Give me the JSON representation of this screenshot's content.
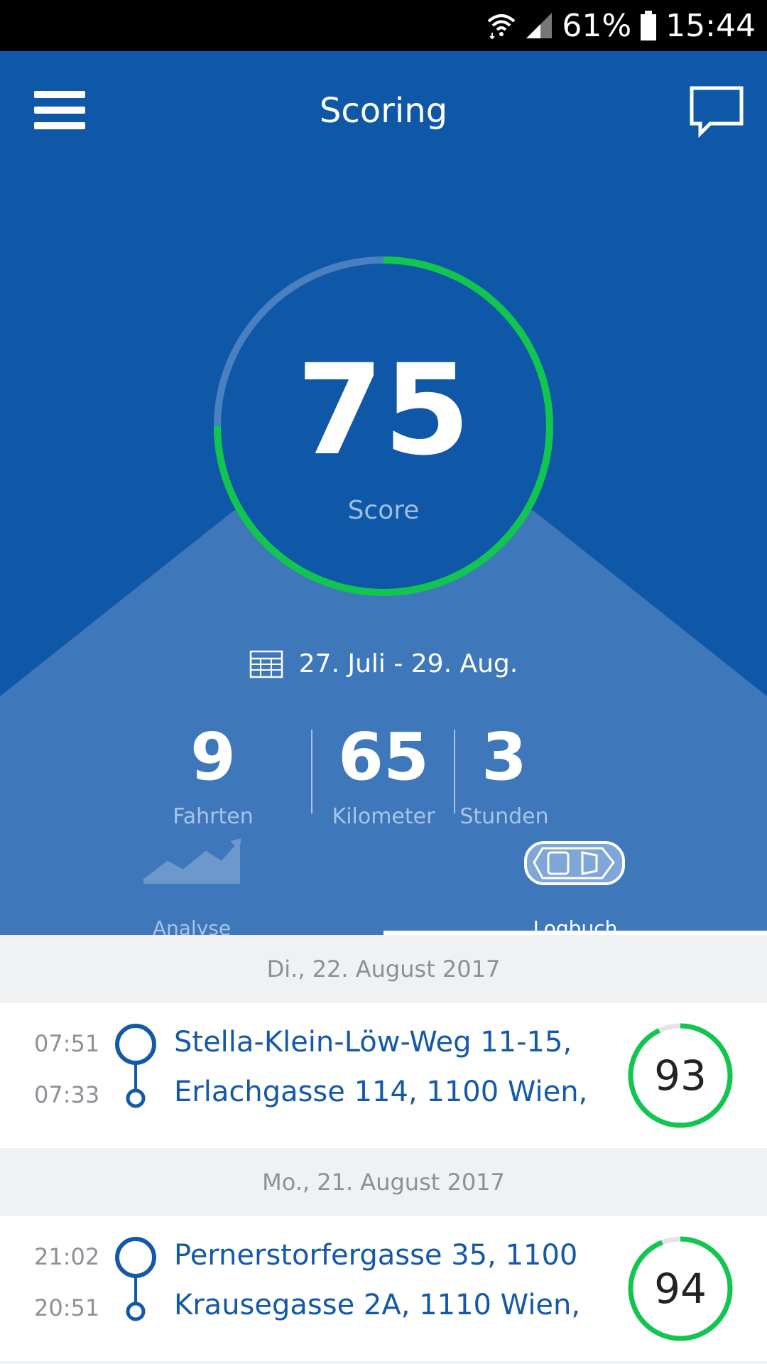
{
  "status_bar": {
    "battery": "61%",
    "time": "15:44"
  },
  "appbar": {
    "title": "Scoring"
  },
  "score": {
    "value": "75",
    "label": "Score",
    "fraction": 0.75
  },
  "period": {
    "range": "27. Juli - 29. Aug."
  },
  "stats": [
    {
      "value": "9",
      "label": "Fahrten"
    },
    {
      "value": "65",
      "label": "Kilometer"
    },
    {
      "value": "3",
      "label": "Stunden"
    }
  ],
  "tabs": [
    {
      "label": "Analyse",
      "active": false
    },
    {
      "label": "Logbuch",
      "active": true
    }
  ],
  "trip_groups": [
    {
      "date": "Di., 22. August 2017",
      "trip": {
        "end_time": "07:51",
        "start_time": "07:33",
        "end_address": "Stella-Klein-Löw-Weg 11-15,",
        "start_address": "Erlachgasse 114, 1100 Wien,",
        "score": "93",
        "score_fraction": 0.93
      }
    },
    {
      "date": "Mo., 21. August 2017",
      "trip": {
        "end_time": "21:02",
        "start_time": "20:51",
        "end_address": "Pernerstorfergasse 35, 1100",
        "start_address": "Krausegasse 2A, 1110 Wien,",
        "score": "94",
        "score_fraction": 0.94
      }
    }
  ],
  "colors": {
    "primary": "#0f57a7",
    "accent_green": "#10c64f",
    "link_blue": "#1459a9"
  }
}
